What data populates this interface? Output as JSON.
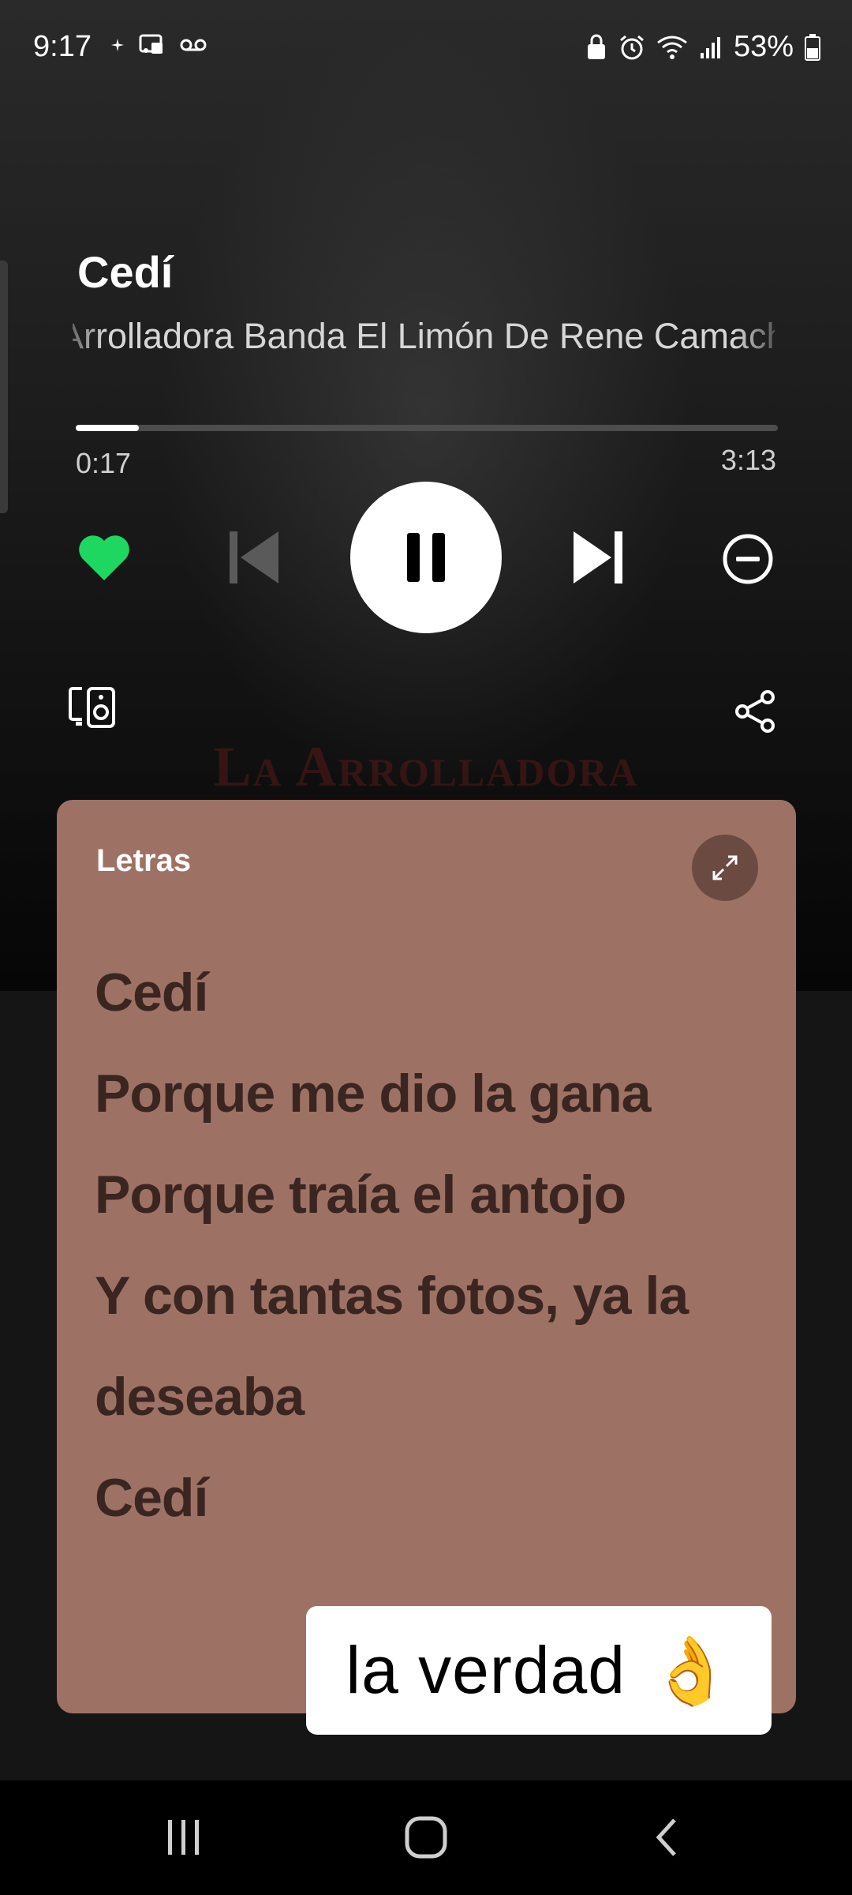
{
  "status_bar": {
    "time": "9:17",
    "battery_percent": "53%",
    "left_icons": [
      "sparkle-icon",
      "cast-icon",
      "voicemail-icon"
    ],
    "right_icons": [
      "lock-icon",
      "alarm-icon",
      "wifi-icon",
      "signal-icon",
      "battery-icon"
    ]
  },
  "album_art": {
    "text": "La Arrolladora"
  },
  "track": {
    "title": "Cedí",
    "artist": "Arrolladora Banda El Limón De Rene Camacho"
  },
  "playback": {
    "elapsed": "0:17",
    "total": "3:13",
    "progress_fraction": 0.09,
    "liked": true,
    "is_playing": true
  },
  "lyrics": {
    "label": "Letras",
    "lines": [
      "Cedí",
      "Porque me dio la gana",
      "Porque traía el antojo",
      "Y con tantas fotos, ya la",
      "deseaba",
      "Cedí"
    ]
  },
  "caption": {
    "text": "la verdad",
    "emoji": "👌"
  },
  "colors": {
    "accent_green": "#1ed760",
    "lyrics_card": "#9d7264",
    "lyrics_text": "#3b2521"
  }
}
